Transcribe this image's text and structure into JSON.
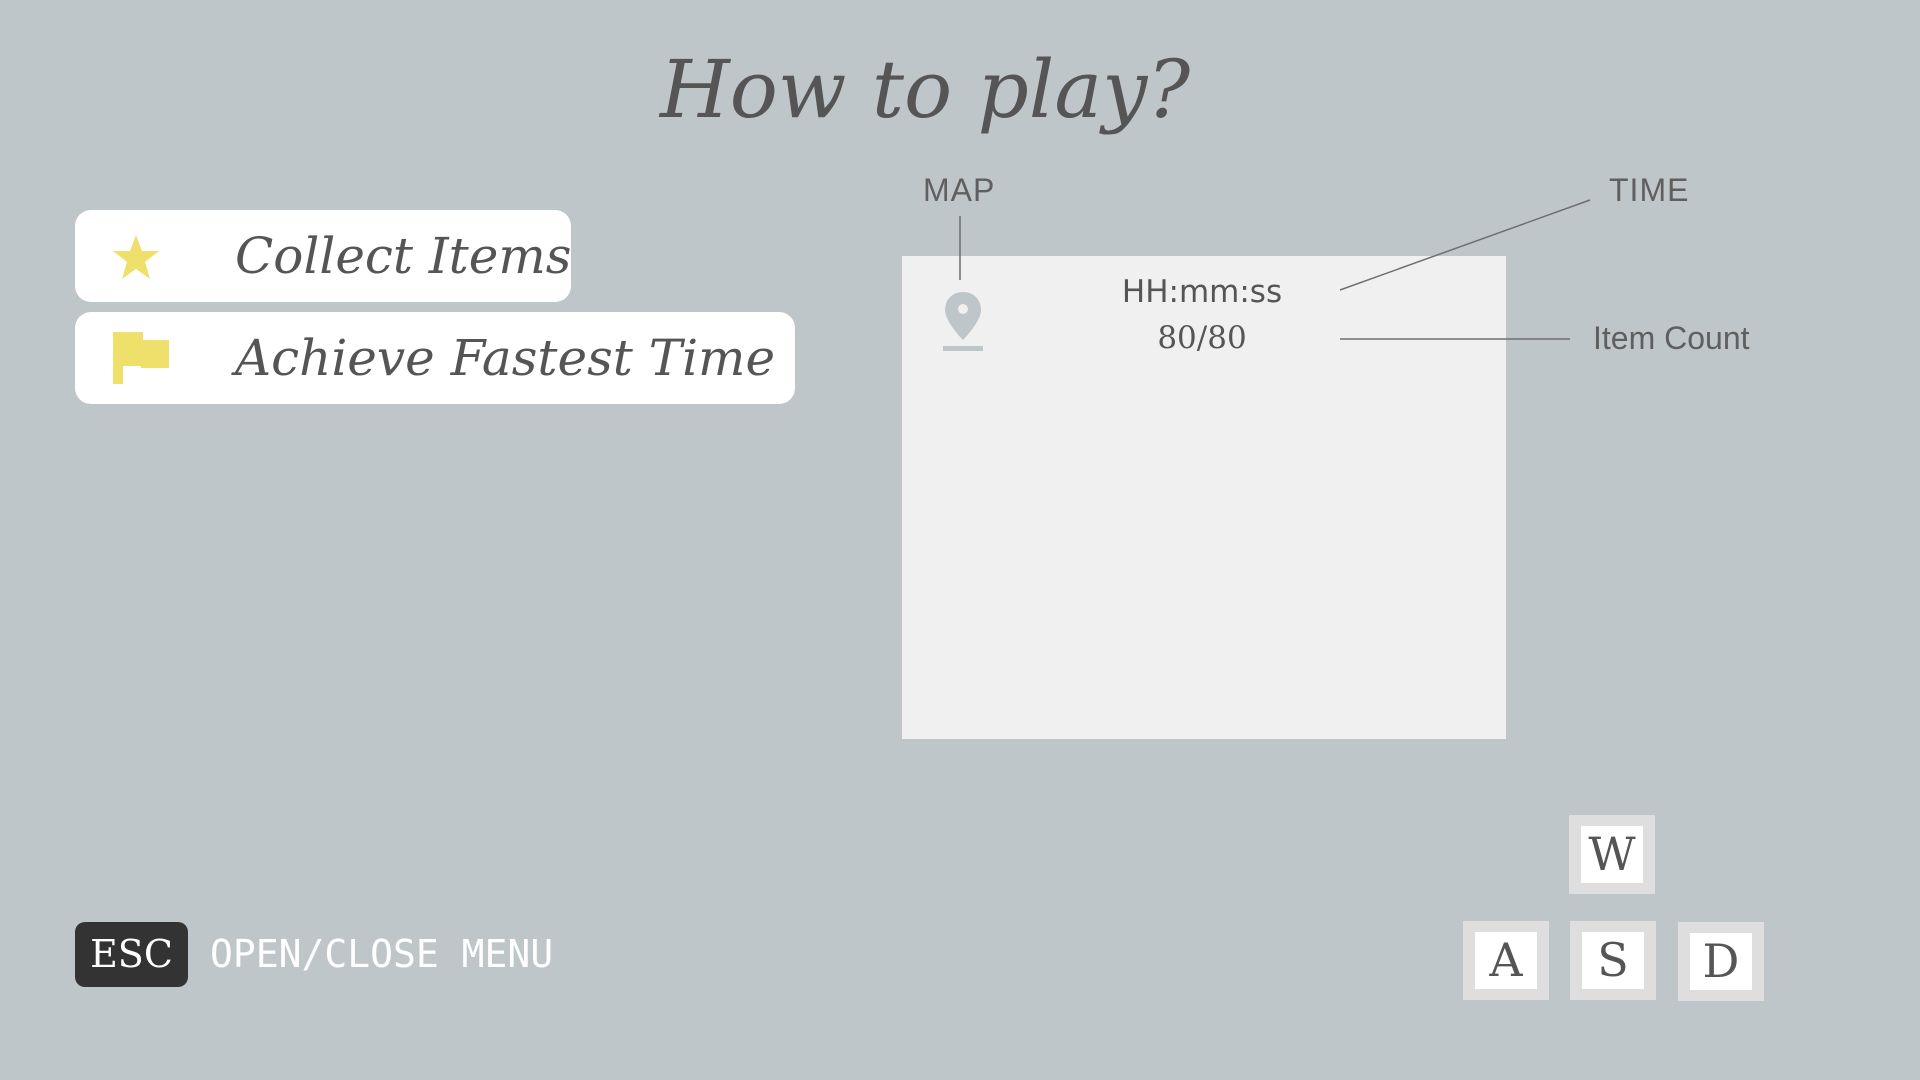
{
  "title": "How to play?",
  "goals": [
    {
      "label": "Collect Items",
      "icon": "star-icon"
    },
    {
      "label": "Achieve Fastest Time",
      "icon": "flag-icon"
    }
  ],
  "hud": {
    "map_label": "MAP",
    "time_label": "TIME",
    "item_count_label": "Item Count",
    "time_value": "HH:mm:ss",
    "item_count_value": "80/80",
    "map_icon": "location-pin-icon"
  },
  "controls": {
    "menu_key": "ESC",
    "menu_action": "OPEN/CLOSE MENU",
    "movement_keys": {
      "up": "W",
      "left": "A",
      "down": "S",
      "right": "D"
    }
  },
  "colors": {
    "background": "#bfc6ca",
    "accent_yellow": "#efe06b",
    "text": "#555555",
    "panel": "#f0f0f0",
    "esc_key": "#333333"
  }
}
